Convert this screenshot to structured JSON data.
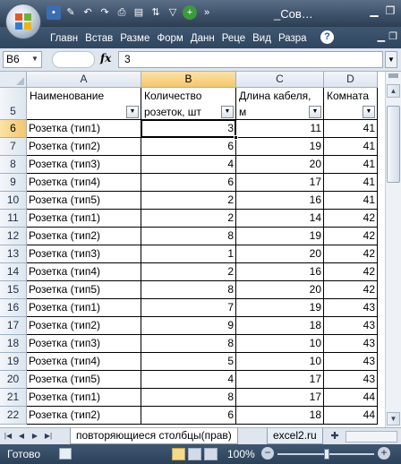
{
  "window": {
    "title": "_Сов…"
  },
  "ribbon": {
    "tabs": [
      "Главн",
      "Встав",
      "Разме",
      "Форм",
      "Данн",
      "Реце",
      "Вид",
      "Разра"
    ]
  },
  "formula_bar": {
    "name_box": "B6",
    "fx_label": "fx",
    "value": "3"
  },
  "sheet": {
    "columns": [
      "A",
      "B",
      "C",
      "D"
    ],
    "header_row": {
      "row_number": "5",
      "cells": [
        "Наименование",
        "Количество розеток, шт",
        "Длина кабеля, м",
        "Комната"
      ]
    },
    "rows": [
      {
        "n": "6",
        "name": "Розетка (тип1)",
        "qty": "3",
        "len": "11",
        "room": "41"
      },
      {
        "n": "7",
        "name": "Розетка (тип2)",
        "qty": "6",
        "len": "19",
        "room": "41"
      },
      {
        "n": "8",
        "name": "Розетка (тип3)",
        "qty": "4",
        "len": "20",
        "room": "41"
      },
      {
        "n": "9",
        "name": "Розетка (тип4)",
        "qty": "6",
        "len": "17",
        "room": "41"
      },
      {
        "n": "10",
        "name": "Розетка (тип5)",
        "qty": "2",
        "len": "16",
        "room": "41"
      },
      {
        "n": "11",
        "name": "Розетка (тип1)",
        "qty": "2",
        "len": "14",
        "room": "42"
      },
      {
        "n": "12",
        "name": "Розетка (тип2)",
        "qty": "8",
        "len": "19",
        "room": "42"
      },
      {
        "n": "13",
        "name": "Розетка (тип3)",
        "qty": "1",
        "len": "20",
        "room": "42"
      },
      {
        "n": "14",
        "name": "Розетка (тип4)",
        "qty": "2",
        "len": "16",
        "room": "42"
      },
      {
        "n": "15",
        "name": "Розетка (тип5)",
        "qty": "8",
        "len": "20",
        "room": "42"
      },
      {
        "n": "16",
        "name": "Розетка (тип1)",
        "qty": "7",
        "len": "19",
        "room": "43"
      },
      {
        "n": "17",
        "name": "Розетка (тип2)",
        "qty": "9",
        "len": "18",
        "room": "43"
      },
      {
        "n": "18",
        "name": "Розетка (тип3)",
        "qty": "8",
        "len": "10",
        "room": "43"
      },
      {
        "n": "19",
        "name": "Розетка (тип4)",
        "qty": "5",
        "len": "10",
        "room": "43"
      },
      {
        "n": "20",
        "name": "Розетка (тип5)",
        "qty": "4",
        "len": "17",
        "room": "43"
      },
      {
        "n": "21",
        "name": "Розетка (тип1)",
        "qty": "8",
        "len": "17",
        "room": "44"
      },
      {
        "n": "22",
        "name": "Розетка (тип2)",
        "qty": "6",
        "len": "18",
        "room": "44"
      }
    ]
  },
  "sheet_tabs": {
    "active": "повторяющиеся столбцы(прав)",
    "other": "excel2.ru"
  },
  "status": {
    "ready": "Готово",
    "zoom": "100%",
    "minus": "−",
    "plus": "+"
  }
}
